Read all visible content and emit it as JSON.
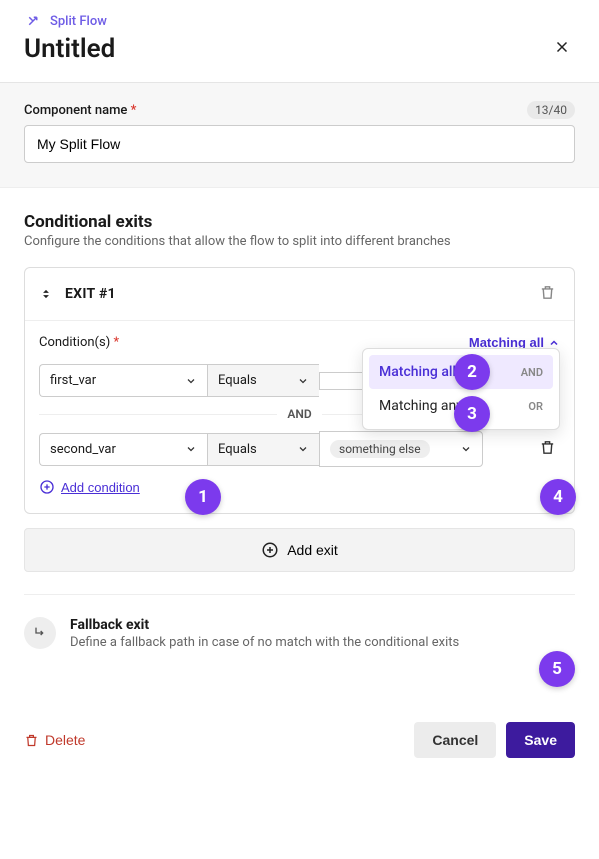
{
  "header": {
    "component_type": "Split Flow",
    "title": "Untitled"
  },
  "name_section": {
    "label": "Component name",
    "value": "My Split Flow",
    "counter": "13/40"
  },
  "conditional": {
    "title": "Conditional exits",
    "subtitle": "Configure the conditions that allow the flow to split into different branches",
    "exit_label": "EXIT #1",
    "conditions_label": "Condition(s)",
    "match_mode": "Matching all",
    "dropdown": {
      "all": "Matching all",
      "all_tag": "AND",
      "any": "Matching any",
      "any_tag": "OR"
    },
    "rows": [
      {
        "var": "first_var",
        "op": "Equals",
        "val": ""
      },
      {
        "var": "second_var",
        "op": "Equals",
        "val": "something else"
      }
    ],
    "and_label": "AND",
    "add_condition": "Add condition",
    "add_exit": "Add exit"
  },
  "fallback": {
    "title": "Fallback exit",
    "subtitle": "Define a fallback path in case of no match with the conditional exits"
  },
  "footer": {
    "delete": "Delete",
    "cancel": "Cancel",
    "save": "Save"
  },
  "markers": [
    "1",
    "2",
    "3",
    "4",
    "5"
  ]
}
